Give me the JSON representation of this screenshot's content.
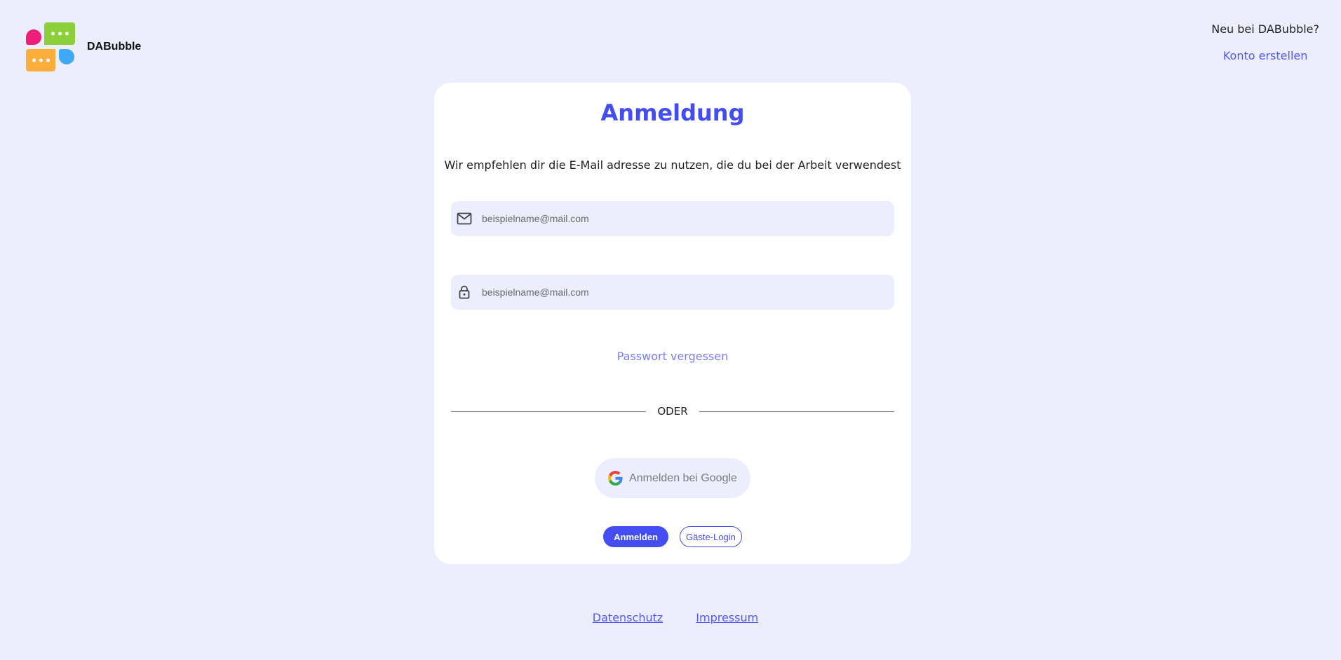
{
  "brand": {
    "name": "DABubble"
  },
  "header": {
    "new_text": "Neu bei DABubble?",
    "create_account": "Konto erstellen"
  },
  "login": {
    "title": "Anmeldung",
    "subtitle": "Wir empfehlen dir die E-Mail adresse zu nutzen, die du bei der Arbeit verwendest",
    "email_placeholder": "beispielname@mail.com",
    "email_value": "",
    "password_placeholder": "beispielname@mail.com",
    "password_value": "",
    "forgot_password": "Passwort vergessen",
    "divider": "ODER",
    "google_button": "Anmelden bei Google",
    "login_button": "Anmelden",
    "guest_button": "Gäste-Login"
  },
  "footer": {
    "privacy": "Datenschutz",
    "imprint": "Impressum"
  },
  "icons": {
    "email": "mail-icon",
    "password": "lock-icon",
    "google": "google-icon",
    "logo": "dabubble-logo-icon"
  },
  "colors": {
    "background": "#eceefe",
    "accent": "#444df2",
    "link": "#535af1",
    "forgot": "#797ef3",
    "logo_pink": "#ec1e79",
    "logo_green": "#8dcf3a",
    "logo_orange": "#fbae3c",
    "logo_blue": "#3fa9f5"
  }
}
